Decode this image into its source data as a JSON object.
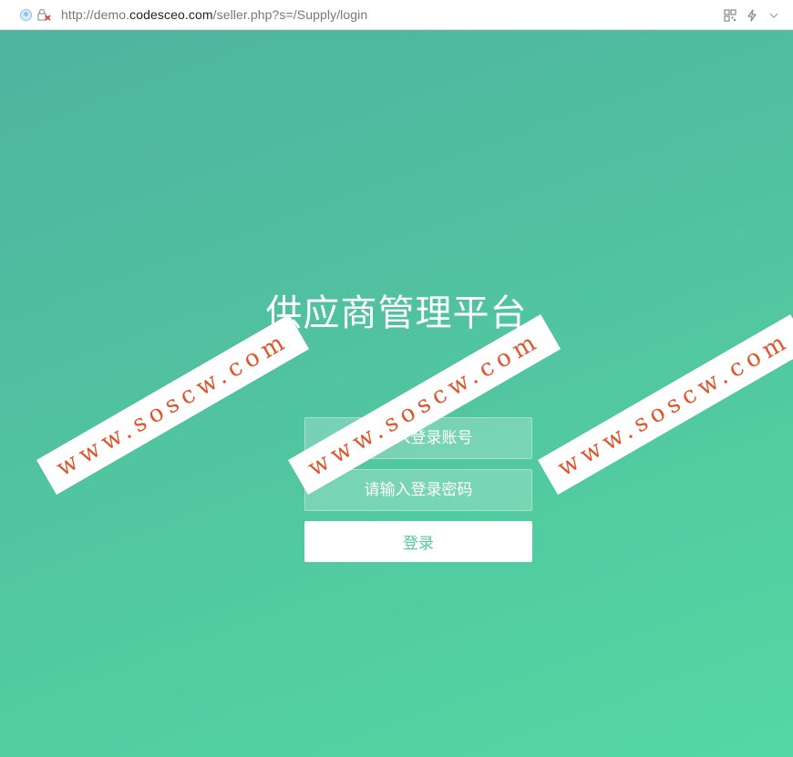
{
  "browser": {
    "url_prefix": "http://demo.",
    "url_domain": "codesceo.com",
    "url_path": "/seller.php?s=/Supply/login",
    "icons": [
      "globe-icon",
      "insecure-lock-icon",
      "qr-code-icon",
      "lightning-icon",
      "chevron-down-icon"
    ]
  },
  "page": {
    "title": "供应商管理平台",
    "username_placeholder": "请输入登录账号",
    "password_placeholder": "请输入登录密码",
    "login_label": "登录"
  },
  "watermark": {
    "text": "www.soscw.com"
  },
  "colors": {
    "gradient_start": "#4fb3a0",
    "gradient_end": "#54d8a3",
    "button_text": "#55c99d",
    "watermark_text": "#e0532b"
  }
}
